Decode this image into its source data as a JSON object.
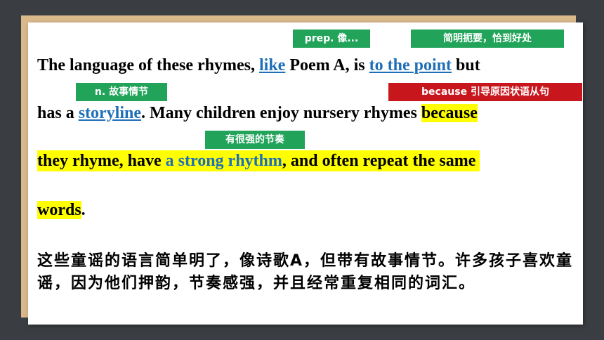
{
  "tags": {
    "prep": "prep. 像...",
    "to_the_point": "简明扼要，恰到好处",
    "storyline": "n. 故事情节",
    "because": "because 引导原因状语从句",
    "rhythm": "有很强的节奏"
  },
  "line1": {
    "a": "The language of these rhymes, ",
    "like": "like",
    "b": " Poem A, is ",
    "to_the_point": "to the point",
    "c": " but"
  },
  "line2": {
    "a": "has a ",
    "storyline": "storyline",
    "b": ".  Many children enjoy nursery rhymes ",
    "because": "because"
  },
  "line3": {
    "a": "they rhyme, have ",
    "rhythm": "a strong rhythm",
    "b": ", and often repeat the same"
  },
  "line4": {
    "words": "words",
    "period": "."
  },
  "translation": "这些童谣的语言简单明了，像诗歌A，但带有故事情节。许多孩子喜欢童谣，因为他们押韵，节奏感强，并且经常重复相同的词汇。",
  "colors": {
    "background": "#3a3d42",
    "backdrop": "#d9b98a",
    "highlight": "#ffff00",
    "blue": "#1f6fb8",
    "green_tag": "#21a35a",
    "red_tag": "#c8161d"
  }
}
